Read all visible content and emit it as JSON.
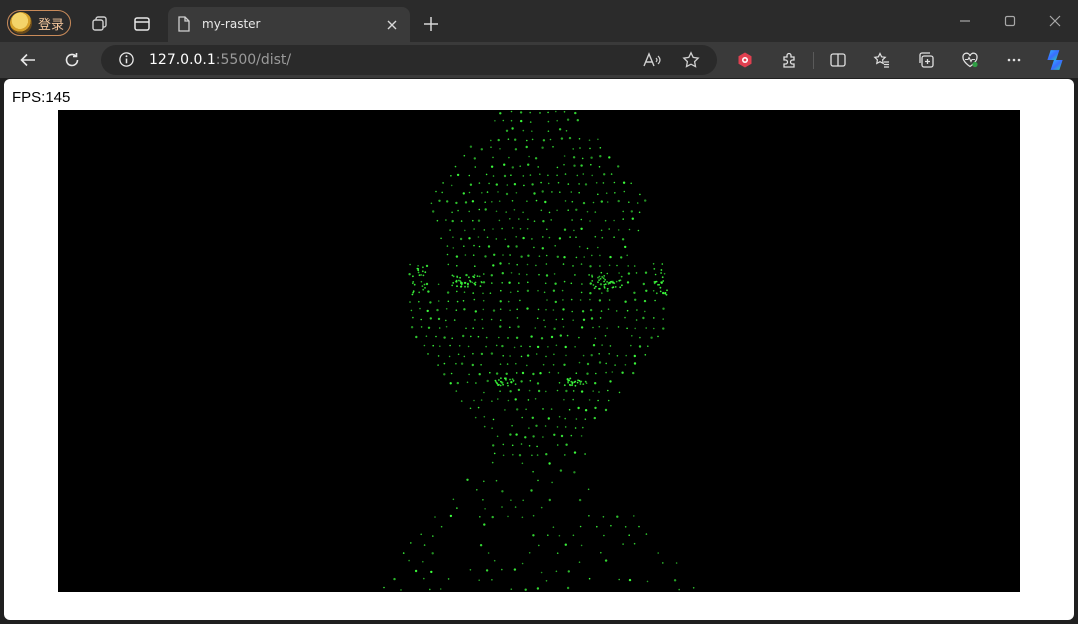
{
  "profile": {
    "label": "登录"
  },
  "tab": {
    "title": "my-raster"
  },
  "address": {
    "host": "127.0.0.1",
    "path": ":5500/dist/"
  },
  "page": {
    "fps_text": "FPS:145"
  },
  "colors": {
    "point_color": "#3cff3c",
    "canvas_bg": "#000000",
    "accent_icon": "#e04050"
  },
  "icons": [
    "back-icon",
    "refresh-icon",
    "info-icon",
    "read-aloud-icon",
    "favorite-star-icon",
    "extension-hex-icon",
    "extensions-puzzle-icon",
    "split-screen-icon",
    "favorites-icon",
    "collections-icon",
    "browser-essentials-icon",
    "more-icon",
    "copilot-icon"
  ]
}
